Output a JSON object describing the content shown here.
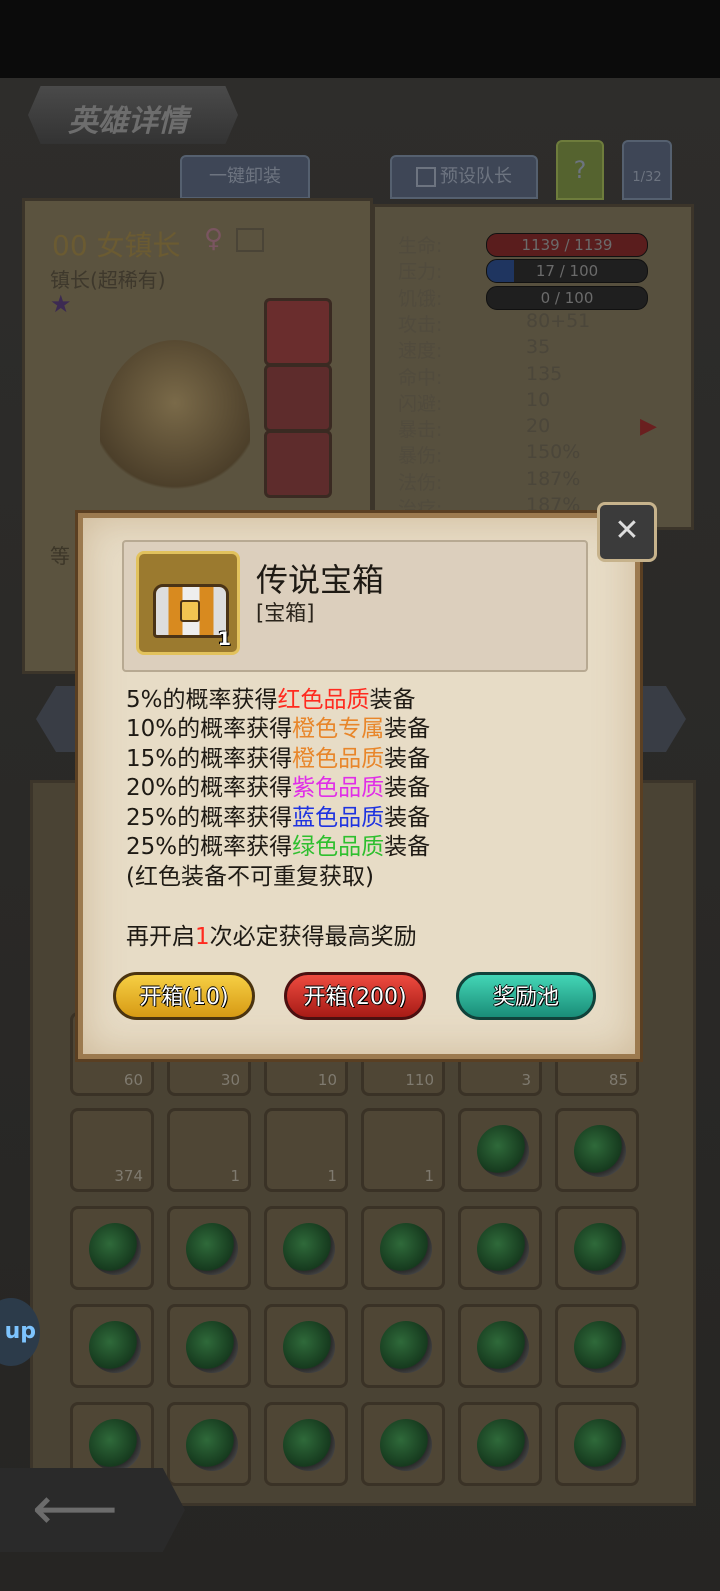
{
  "header": {
    "title": "英雄详情"
  },
  "tabs": {
    "unequip_all": "一键卸装",
    "preset_team": "预设队长",
    "help": "?",
    "page": "1/32"
  },
  "hero": {
    "name": "00 女镇长",
    "class": "镇长(超稀有)",
    "level_label": "等"
  },
  "stats": [
    {
      "label": "生命:",
      "value": "1139 / 1139",
      "kind": "bar-red"
    },
    {
      "label": "压力:",
      "value": "17 / 100",
      "kind": "bar-blue"
    },
    {
      "label": "饥饿:",
      "value": "0 / 100",
      "kind": "bar-dark"
    },
    {
      "label": "攻击:",
      "value": "80+51"
    },
    {
      "label": "速度:",
      "value": "35"
    },
    {
      "label": "命中:",
      "value": "135"
    },
    {
      "label": "闪避:",
      "value": "10"
    },
    {
      "label": "暴击:",
      "value": "20"
    },
    {
      "label": "暴伤:",
      "value": "150%"
    },
    {
      "label": "法伤:",
      "value": "187%"
    },
    {
      "label": "治疗:",
      "value": "187%"
    }
  ],
  "inventory": {
    "row1_counts": [
      "60",
      "30",
      "10",
      "110",
      "3",
      "85"
    ],
    "row2_counts": [
      "374",
      "1",
      "1",
      "1",
      "",
      ""
    ]
  },
  "dialog": {
    "item_name": "传说宝箱",
    "item_type": "[宝箱]",
    "item_count": "1",
    "lines": [
      {
        "pre": "5%的概率获得",
        "hl": "红色品质",
        "post": "装备",
        "color": "#ff2a1f"
      },
      {
        "pre": "10%的概率获得",
        "hl": "橙色专属",
        "post": "装备",
        "color": "#e8862a"
      },
      {
        "pre": "15%的概率获得",
        "hl": "橙色品质",
        "post": "装备",
        "color": "#e8862a"
      },
      {
        "pre": "20%的概率获得",
        "hl": "紫色品质",
        "post": "装备",
        "color": "#e02ee8"
      },
      {
        "pre": "25%的概率获得",
        "hl": "蓝色品质",
        "post": "装备",
        "color": "#1f33e0"
      },
      {
        "pre": "25%的概率获得",
        "hl": "绿色品质",
        "post": "装备",
        "color": "#2ebf2e"
      }
    ],
    "note": "(红色装备不可重复获取)",
    "guarantee_pre": "再开启",
    "guarantee_num": "1",
    "guarantee_post": "次必定获得最高奖励",
    "guarantee_color": "#ff2a1f",
    "btn_open10": "开箱(10)",
    "btn_open200": "开箱(200)",
    "btn_pool": "奖励池"
  },
  "side_button": "up"
}
